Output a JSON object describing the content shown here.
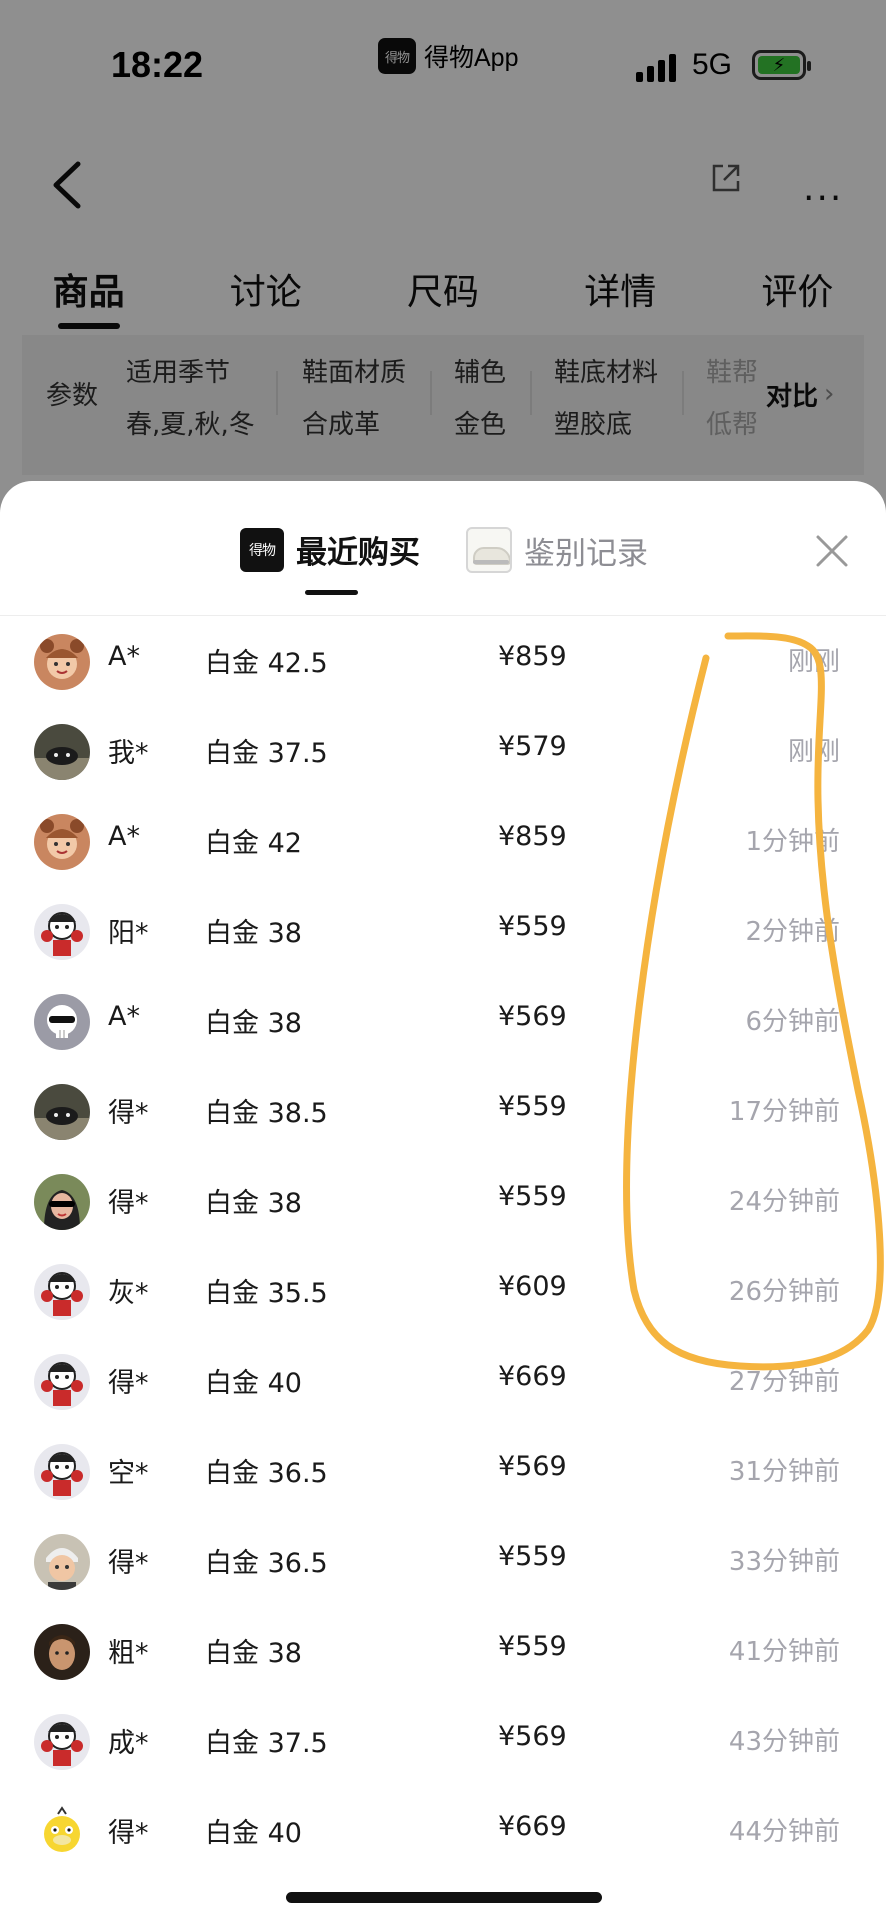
{
  "status_bar": {
    "time": "18:22",
    "app_name": "得物App",
    "app_logo": "得物",
    "network": "5G",
    "battery_icon": "charging-battery"
  },
  "nav": {
    "back_icon": "chevron-left-icon",
    "share_icon": "share-icon",
    "more_icon": "more-icon",
    "more_glyph": "···"
  },
  "tabs": [
    {
      "label": "商品",
      "active": true
    },
    {
      "label": "讨论",
      "active": false
    },
    {
      "label": "尺码",
      "active": false
    },
    {
      "label": "详情",
      "active": false
    },
    {
      "label": "评价",
      "active": false
    }
  ],
  "params": {
    "label": "参数",
    "items": [
      {
        "key": "适用季节",
        "value": "春,夏,秋,冬"
      },
      {
        "key": "鞋面材质",
        "value": "合成革"
      },
      {
        "key": "辅色",
        "value": "金色"
      },
      {
        "key": "鞋底材料",
        "value": "塑胶底"
      },
      {
        "key": "鞋帮",
        "value": "低帮"
      }
    ],
    "compare_label": "对比",
    "compare_chevron": "›"
  },
  "sheet": {
    "tab_recent": "最近购买",
    "tab_recent_logo": "得物",
    "tab_auth": "鉴别记录",
    "close_icon": "close-icon"
  },
  "purchases": [
    {
      "avatar": "girl-photo",
      "name": "A*",
      "size": "白金 42.5",
      "price": "¥859",
      "time": "刚刚"
    },
    {
      "avatar": "dark-photo",
      "name": "我*",
      "size": "白金 37.5",
      "price": "¥579",
      "time": "刚刚"
    },
    {
      "avatar": "girl-photo",
      "name": "A*",
      "size": "白金 42",
      "price": "¥859",
      "time": "1分钟前"
    },
    {
      "avatar": "cartoon-red",
      "name": "阳*",
      "size": "白金 38",
      "price": "¥559",
      "time": "2分钟前"
    },
    {
      "avatar": "skull-sunglasses",
      "name": "A*",
      "size": "白金 38",
      "price": "¥569",
      "time": "6分钟前"
    },
    {
      "avatar": "dark-photo",
      "name": "得*",
      "size": "白金 38.5",
      "price": "¥559",
      "time": "17分钟前"
    },
    {
      "avatar": "sunglasses-girl",
      "name": "得*",
      "size": "白金 38",
      "price": "¥559",
      "time": "24分钟前"
    },
    {
      "avatar": "cartoon-red",
      "name": "灰*",
      "size": "白金 35.5",
      "price": "¥609",
      "time": "26分钟前"
    },
    {
      "avatar": "cartoon-red",
      "name": "得*",
      "size": "白金 40",
      "price": "¥669",
      "time": "27分钟前"
    },
    {
      "avatar": "cartoon-red",
      "name": "空*",
      "size": "白金 36.5",
      "price": "¥569",
      "time": "31分钟前"
    },
    {
      "avatar": "kid-photo",
      "name": "得*",
      "size": "白金 36.5",
      "price": "¥559",
      "time": "33分钟前"
    },
    {
      "avatar": "man-photo",
      "name": "粗*",
      "size": "白金 38",
      "price": "¥559",
      "time": "41分钟前"
    },
    {
      "avatar": "cartoon-red",
      "name": "成*",
      "size": "白金 37.5",
      "price": "¥569",
      "time": "43分钟前"
    },
    {
      "avatar": "yellow-duck",
      "name": "得*",
      "size": "白金 40",
      "price": "¥669",
      "time": "44分钟前"
    }
  ],
  "colors": {
    "annotation": "#f5b43f",
    "time_text": "#a5a5ad",
    "dim_overlay": "rgba(0,0,0,0.44)"
  }
}
